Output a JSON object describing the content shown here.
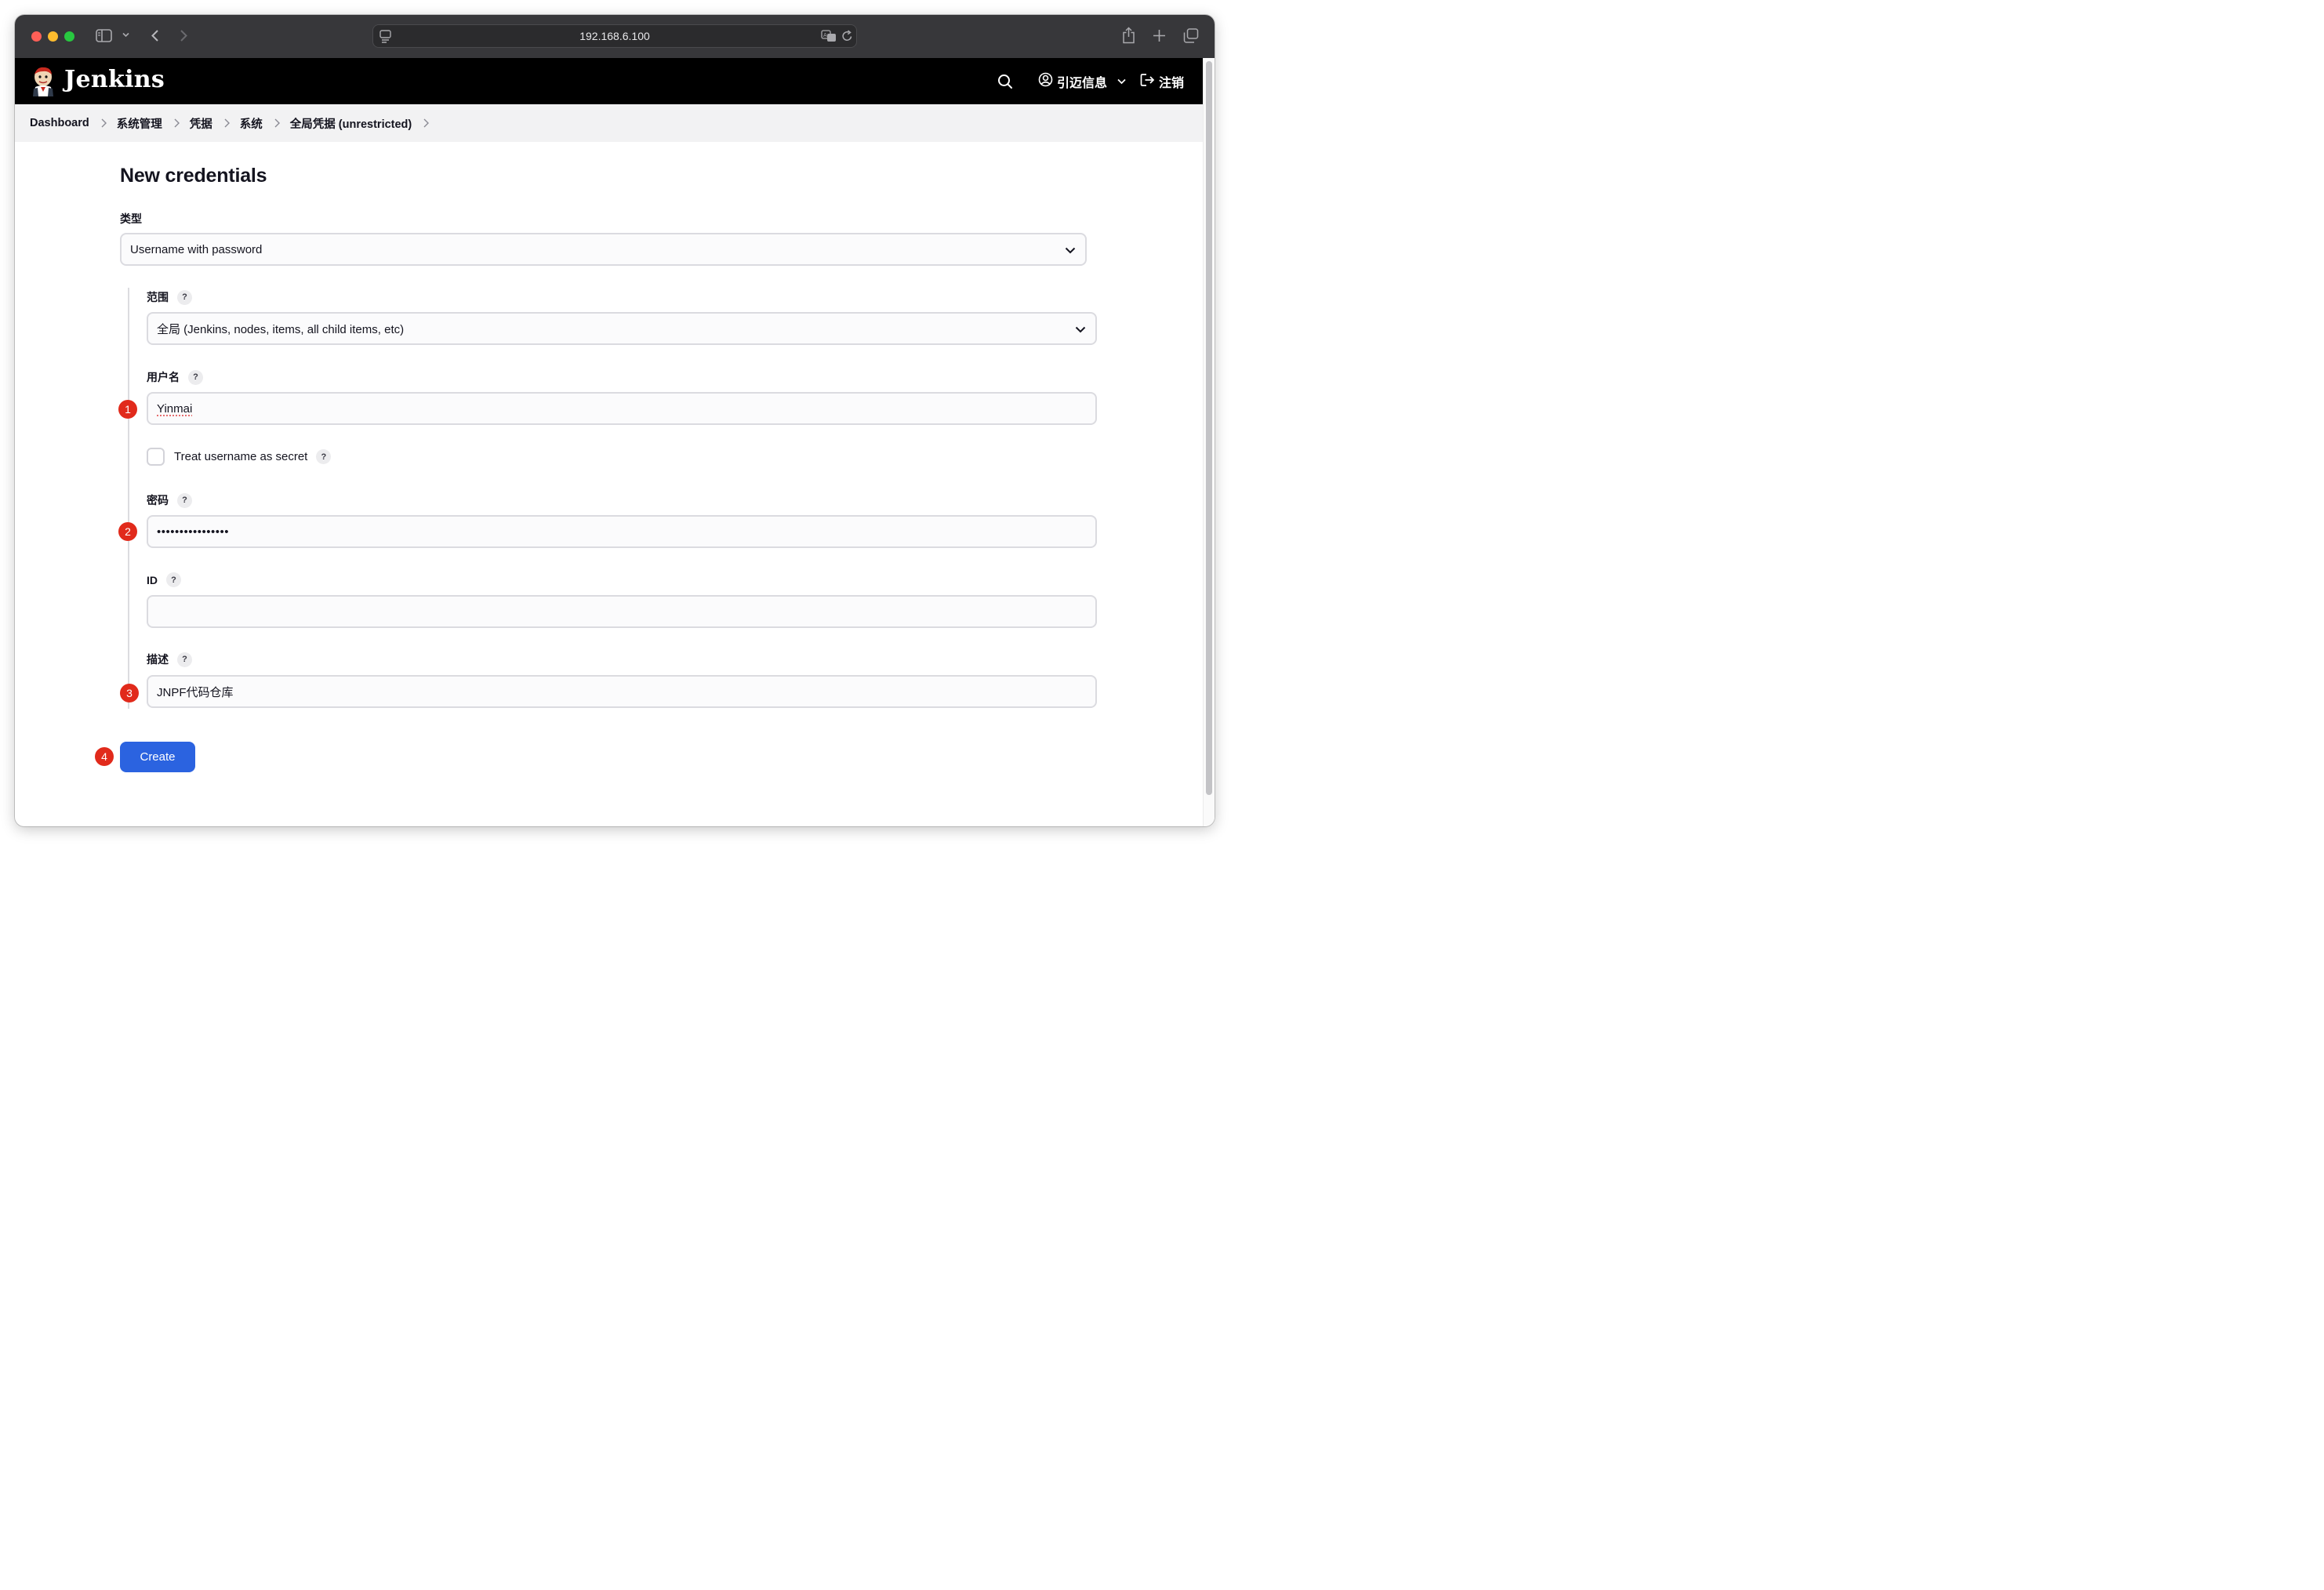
{
  "browser": {
    "url": "192.168.6.100"
  },
  "header": {
    "brand": "Jenkins",
    "user_name": "引迈信息",
    "logout_label": "注销"
  },
  "breadcrumb": [
    "Dashboard",
    "系统管理",
    "凭据",
    "系统",
    "全局凭据 (unrestricted)"
  ],
  "page": {
    "title": "New credentials"
  },
  "form": {
    "kind_label": "类型",
    "kind_value": "Username with password",
    "scope_label": "范围",
    "scope_value": "全局 (Jenkins, nodes, items, all child items, etc)",
    "username_label": "用户名",
    "username_value": "Yinmai",
    "secret_checkbox_label": "Treat username as secret",
    "secret_checked": false,
    "password_label": "密码",
    "password_value": "••••••••••••••••",
    "id_label": "ID",
    "id_value": "",
    "description_label": "描述",
    "description_value": "JNPF代码仓库",
    "help_glyph": "?",
    "create_label": "Create"
  },
  "annotations": [
    "1",
    "2",
    "3",
    "4"
  ],
  "colors": {
    "header_bg": "#000000",
    "primary_button": "#2b63e0",
    "annotation_badge": "#e12a1b"
  }
}
